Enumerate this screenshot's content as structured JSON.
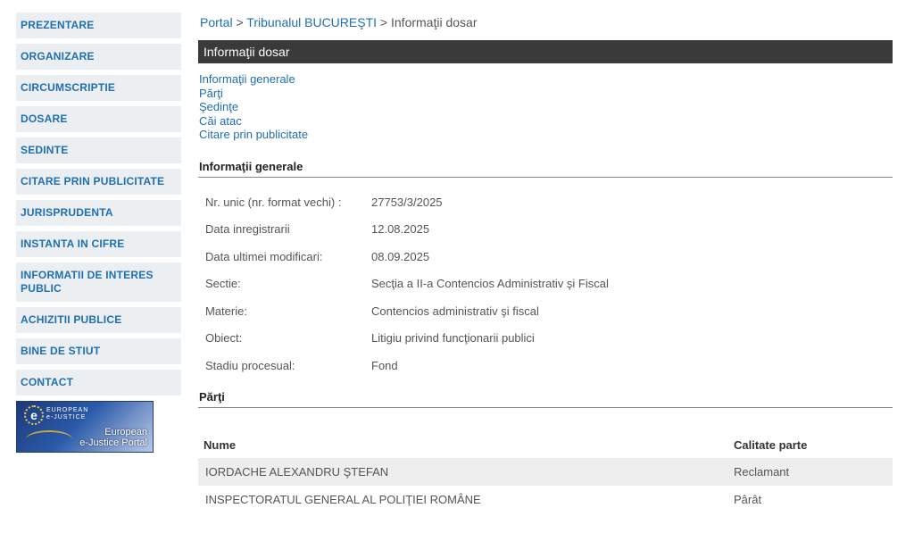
{
  "sidebar": {
    "items": [
      {
        "label": "PREZENTARE"
      },
      {
        "label": "ORGANIZARE"
      },
      {
        "label": "CIRCUMSCRIPTIE"
      },
      {
        "label": "DOSARE"
      },
      {
        "label": "SEDINTE"
      },
      {
        "label": "CITARE PRIN PUBLICITATE"
      },
      {
        "label": "JURISPRUDENTA"
      },
      {
        "label": "INSTANTA IN CIFRE"
      },
      {
        "label": "INFORMATII DE INTERES PUBLIC"
      },
      {
        "label": "ACHIZITII PUBLICE"
      },
      {
        "label": "BINE DE STIUT"
      },
      {
        "label": "CONTACT"
      }
    ],
    "banner": {
      "logo_small": "EUROPEAN\ne-JUSTICE",
      "text_line1": "European",
      "text_line2": "e-Justice Portal"
    }
  },
  "breadcrumb": {
    "portal": "Portal",
    "sep1": " > ",
    "tribunal": "Tribunalul BUCUREŞTI",
    "sep2": " > ",
    "current": "Informaţii dosar"
  },
  "title_bar": "Informaţii dosar",
  "links": [
    "Informaţii generale",
    "Părţi",
    "Şedinţe",
    "Căi atac",
    "Citare prin publicitate"
  ],
  "general": {
    "heading": "Informaţii generale",
    "rows": [
      {
        "label": "Nr. unic (nr. format vechi) :",
        "value": "27753/3/2025"
      },
      {
        "label": "Data inregistrarii",
        "value": "12.08.2025"
      },
      {
        "label": "Data ultimei modificari:",
        "value": "08.09.2025"
      },
      {
        "label": "Sectie:",
        "value": "Secţia a II-a Contencios Administrativ şi Fiscal"
      },
      {
        "label": "Materie:",
        "value": "Contencios administrativ şi fiscal"
      },
      {
        "label": "Obiect:",
        "value": "Litigiu privind funcţionarii publici"
      },
      {
        "label": "Stadiu procesual:",
        "value": "Fond"
      }
    ]
  },
  "parti": {
    "heading": "Părţi",
    "columns": [
      "Nume",
      "Calitate parte"
    ],
    "rows": [
      {
        "nume": "IORDACHE ALEXANDRU ŞTEFAN",
        "calitate": "Reclamant"
      },
      {
        "nume": "INSPECTORATUL GENERAL AL POLIŢIEI ROMÂNE",
        "calitate": "Pârât"
      }
    ]
  }
}
